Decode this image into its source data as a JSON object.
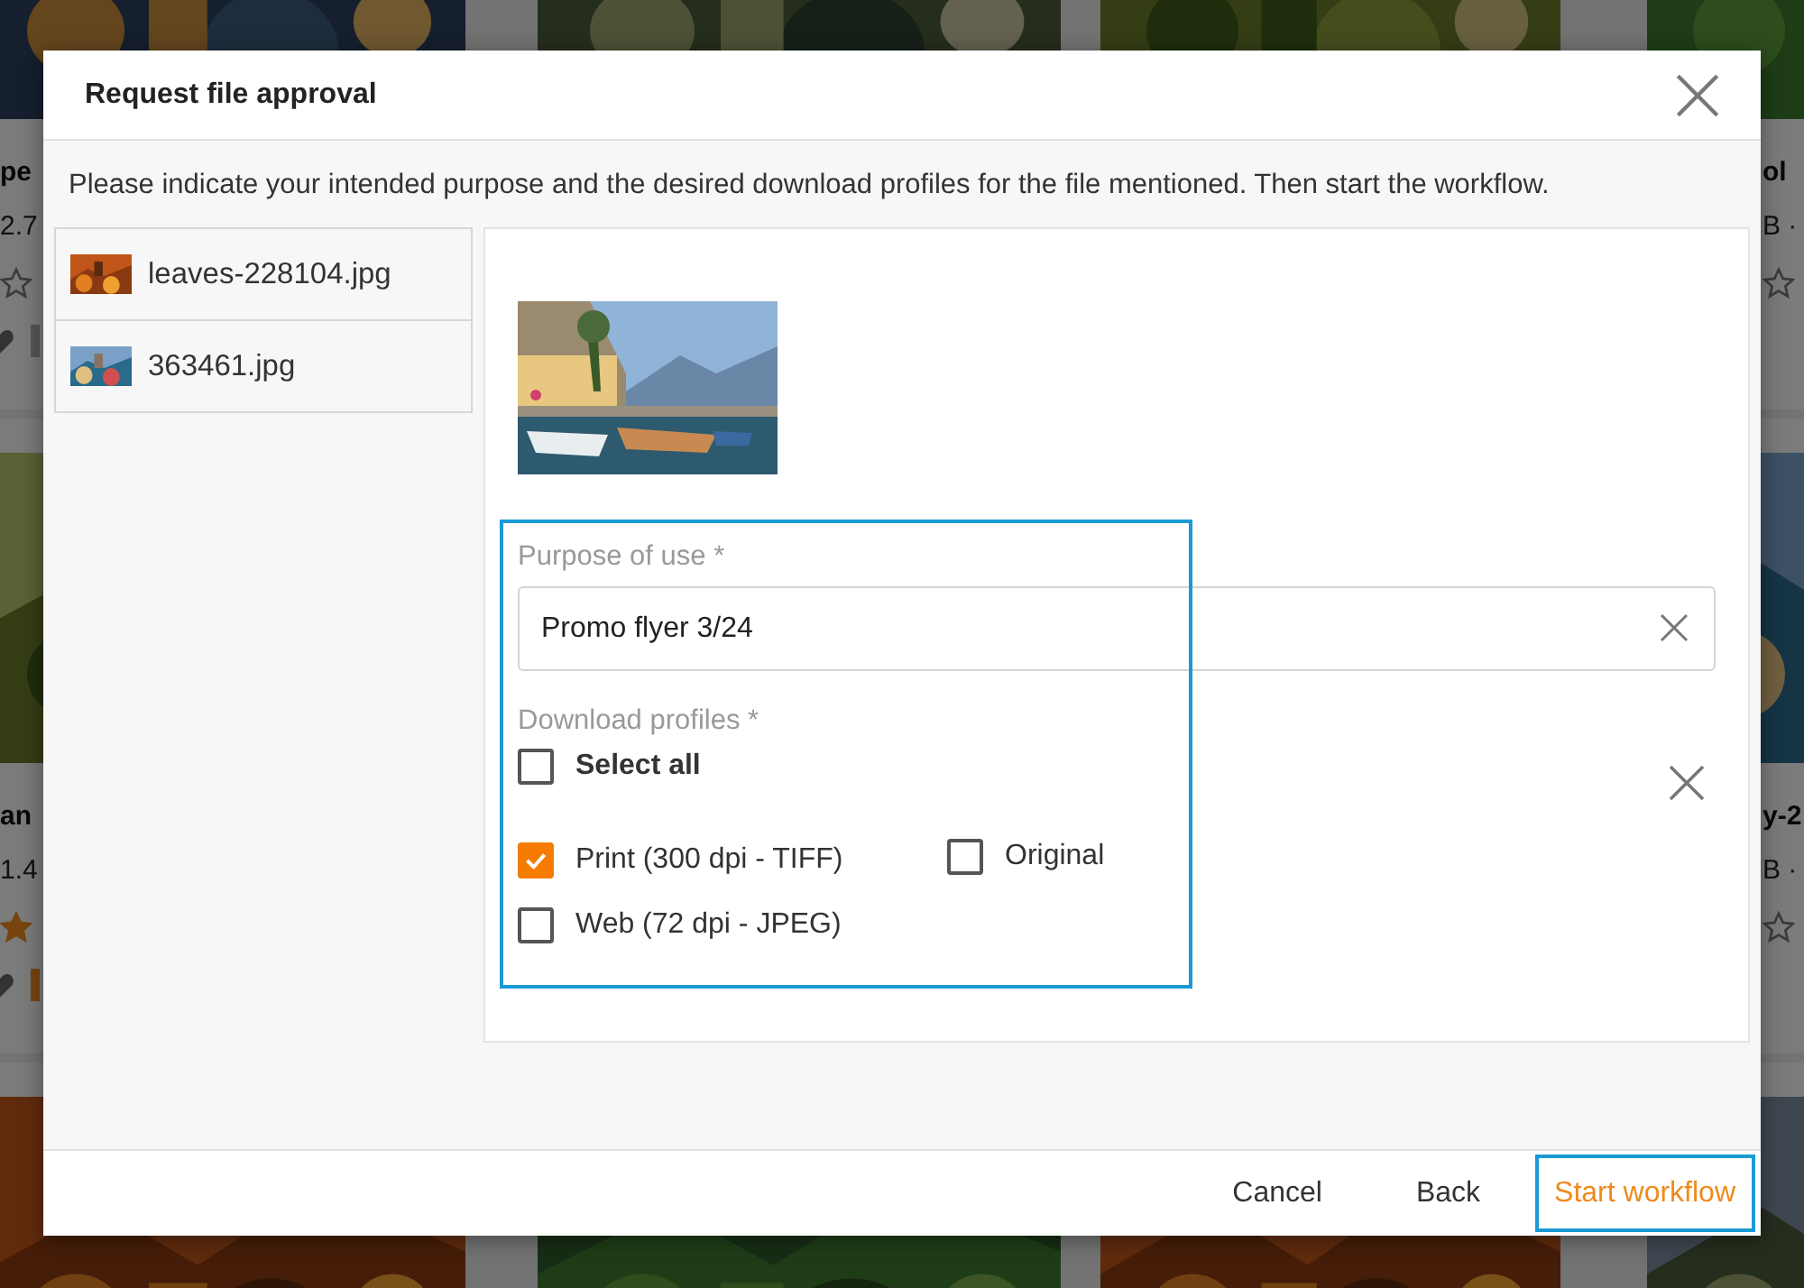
{
  "background": {
    "columns": [
      {
        "cards": [
          {
            "title": "pe",
            "size": "2.7",
            "starred": false,
            "marked": false
          },
          {
            "title": "an",
            "size": "1.4",
            "starred": true,
            "marked": true
          },
          {
            "kind": "picture"
          }
        ]
      },
      {
        "cards": [
          {
            "kind": "picture"
          },
          {
            "kind": "picture"
          }
        ]
      },
      {
        "cards": [
          {
            "kind": "picture"
          },
          {
            "kind": "picture"
          }
        ]
      },
      {
        "cards": [
          {
            "title": "ol",
            "size": "B ·",
            "starred": false
          },
          {
            "title": "y-2",
            "size": "B ·",
            "starred": false
          },
          {
            "kind": "picture"
          }
        ]
      }
    ]
  },
  "dialog": {
    "title": "Request file approval",
    "instructions": "Please indicate your intended purpose and the desired download profiles for the file mentioned. Then start the workflow.",
    "files": [
      {
        "name": "leaves-228104.jpg"
      },
      {
        "name": "363461.jpg"
      }
    ],
    "preview": {
      "kind": "picture"
    },
    "purpose": {
      "label": "Purpose of use *",
      "value": "Promo flyer 3/24"
    },
    "profiles": {
      "label": "Download profiles *",
      "select_all": {
        "label": "Select all",
        "checked": false
      },
      "options": [
        {
          "label": "Print (300 dpi - TIFF)",
          "checked": true
        },
        {
          "label": "Original",
          "checked": false
        },
        {
          "label": "Web (72 dpi - JPEG)",
          "checked": false
        }
      ]
    },
    "buttons": [
      {
        "label": "Cancel",
        "kind": "plain"
      },
      {
        "label": "Back",
        "kind": "plain"
      },
      {
        "label": "Start workflow",
        "kind": "primary"
      }
    ]
  }
}
